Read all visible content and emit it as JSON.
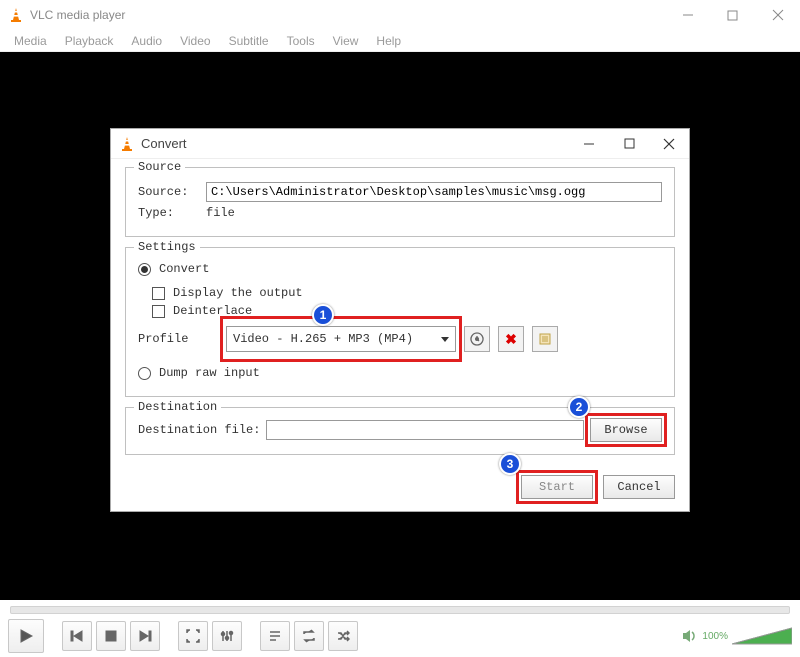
{
  "window": {
    "title": "VLC media player"
  },
  "menubar": {
    "items": [
      "Media",
      "Playback",
      "Audio",
      "Video",
      "Subtitle",
      "Tools",
      "View",
      "Help"
    ]
  },
  "dialog": {
    "title": "Convert",
    "source_group": "Source",
    "source_label": "Source:",
    "source_value": "C:\\Users\\Administrator\\Desktop\\samples\\music\\msg.ogg",
    "type_label": "Type:",
    "type_value": "file",
    "settings_group": "Settings",
    "convert_radio": "Convert",
    "display_output": "Display the output",
    "deinterlace": "Deinterlace",
    "profile_label": "Profile",
    "profile_value": "Video - H.265 + MP3 (MP4)",
    "dump_raw": "Dump raw input",
    "destination_group": "Destination",
    "dest_file_label": "Destination file:",
    "dest_file_value": "",
    "browse": "Browse",
    "start": "Start",
    "cancel": "Cancel"
  },
  "badges": {
    "one": "1",
    "two": "2",
    "three": "3"
  },
  "toolbar": {
    "volume_pct": "100%"
  }
}
